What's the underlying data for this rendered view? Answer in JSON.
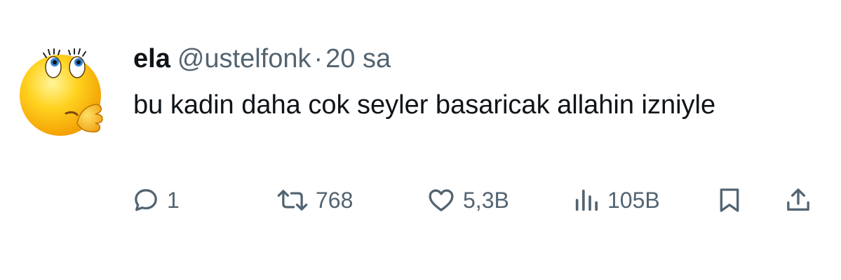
{
  "tweet": {
    "display_name": "ela",
    "handle": "@ustelfonk",
    "separator": "·",
    "time": "20 sa",
    "text": "bu kadin daha cok seyler basaricak allahin izniyle",
    "avatar_icon": "thinking-face-emoji-icon"
  },
  "actions": {
    "reply": {
      "icon": "reply-icon",
      "count": "1"
    },
    "retweet": {
      "icon": "retweet-icon",
      "count": "768"
    },
    "like": {
      "icon": "heart-icon",
      "count": "5,3B"
    },
    "views": {
      "icon": "views-icon",
      "count": "105B"
    },
    "bookmark": {
      "icon": "bookmark-icon"
    },
    "share": {
      "icon": "share-icon"
    }
  },
  "colors": {
    "text_primary": "#0f1419",
    "text_secondary": "#536471",
    "background": "#ffffff"
  }
}
